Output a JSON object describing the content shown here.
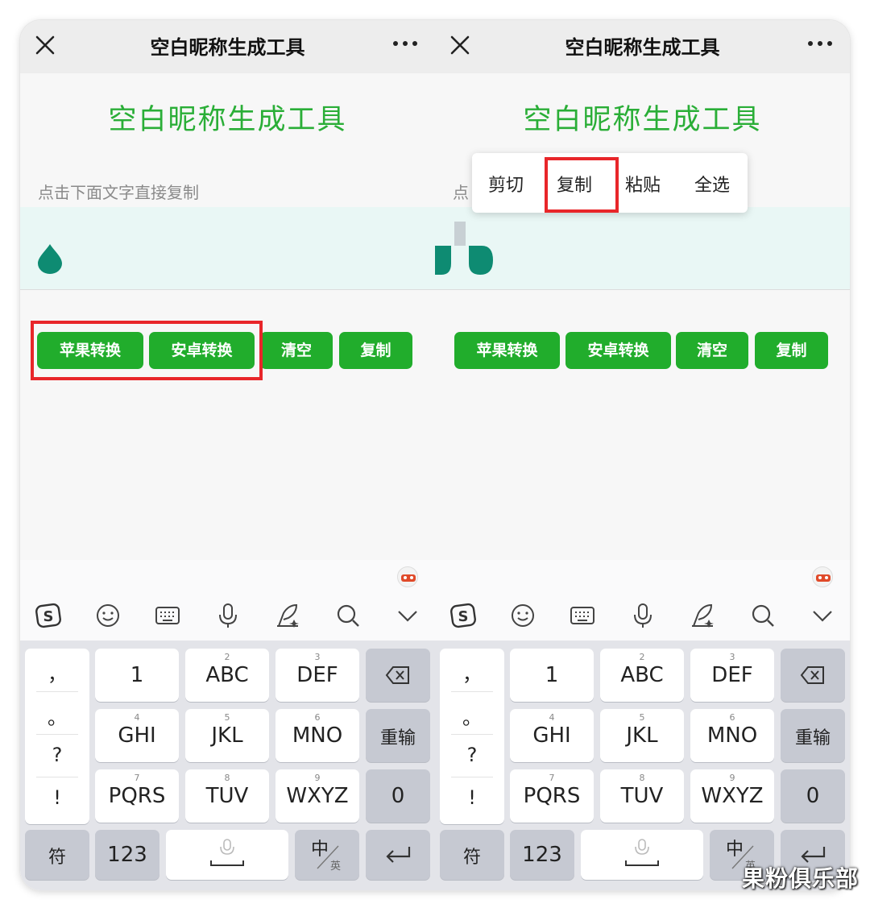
{
  "colors": {
    "accent": "#2aae37",
    "button": "#21ad2c",
    "highlight": "#e8262a",
    "drop": "#0e8b72"
  },
  "left": {
    "title": "空白昵称生成工具",
    "heading": "空白昵称生成工具",
    "hint": "点击下面文字直接复制",
    "buttons": [
      "苹果转换",
      "安卓转换",
      "清空",
      "复制"
    ]
  },
  "right": {
    "title": "空白昵称生成工具",
    "heading": "空白昵称生成工具",
    "hint_fragment": "点",
    "context_menu": [
      "剪切",
      "复制",
      "粘贴",
      "全选"
    ],
    "buttons": [
      "苹果转换",
      "安卓转换",
      "清空",
      "复制"
    ]
  },
  "keyboard": {
    "toolbar_icons": [
      "sogou-icon",
      "emoji-icon",
      "keyboard-icon",
      "microphone-icon",
      "handwriting-icon",
      "search-icon",
      "chevron-down-icon"
    ],
    "punctuation": [
      "，",
      "。",
      "?",
      "!"
    ],
    "rows": [
      [
        {
          "sub": "",
          "main": "1"
        },
        {
          "sub": "2",
          "main": "ABC"
        },
        {
          "sub": "3",
          "main": "DEF"
        }
      ],
      [
        {
          "sub": "4",
          "main": "GHI"
        },
        {
          "sub": "5",
          "main": "JKL"
        },
        {
          "sub": "6",
          "main": "MNO"
        }
      ],
      [
        {
          "sub": "7",
          "main": "PQRS"
        },
        {
          "sub": "8",
          "main": "TUV"
        },
        {
          "sub": "9",
          "main": "WXYZ"
        }
      ]
    ],
    "reinput": "重输",
    "zero": "0",
    "symbols": "符",
    "numbers": "123",
    "lang_main": "中",
    "lang_sub": "英"
  },
  "watermark": "果粉俱乐部"
}
